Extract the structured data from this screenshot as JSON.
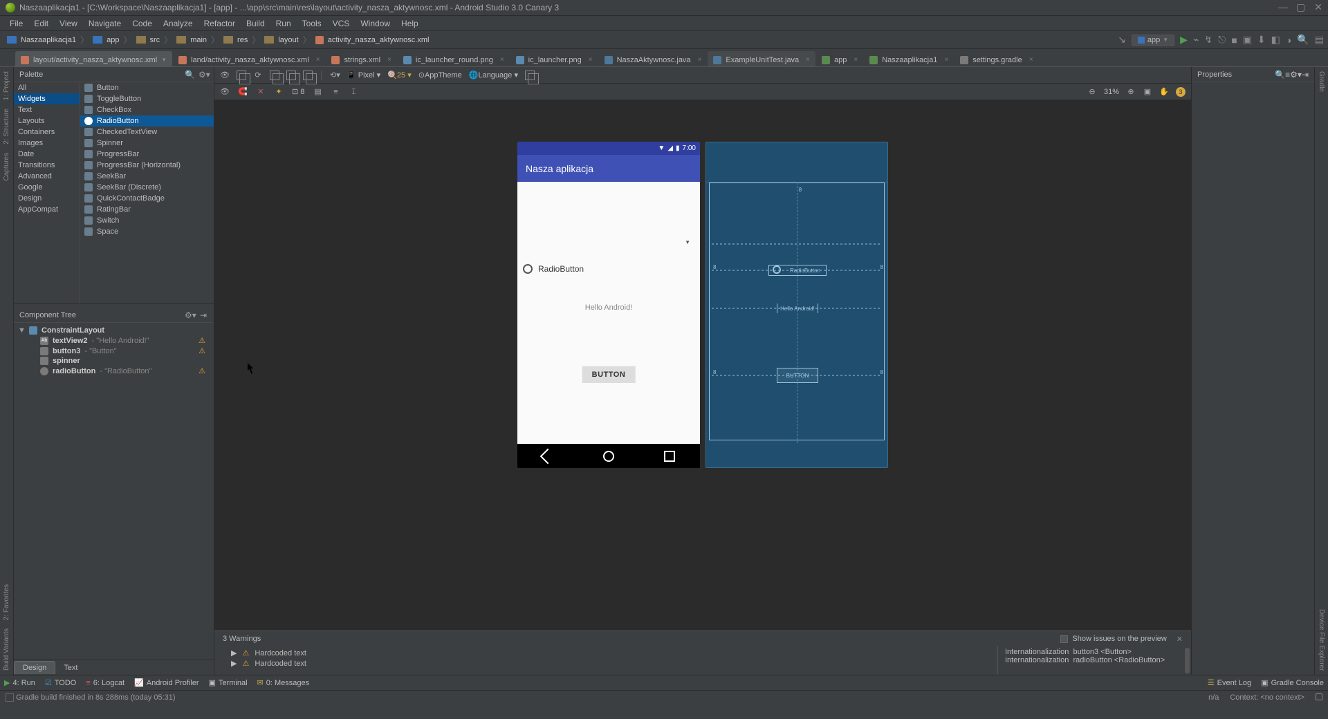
{
  "window": {
    "title": "Naszaaplikacja1 - [C:\\Workspace\\Naszaaplikacja1] - [app] - ...\\app\\src\\main\\res\\layout\\activity_nasza_aktywnosc.xml - Android Studio 3.0 Canary 3"
  },
  "menu": [
    "File",
    "Edit",
    "View",
    "Navigate",
    "Code",
    "Analyze",
    "Refactor",
    "Build",
    "Run",
    "Tools",
    "VCS",
    "Window",
    "Help"
  ],
  "breadcrumb": [
    "Naszaaplikacja1",
    "app",
    "src",
    "main",
    "res",
    "layout",
    "activity_nasza_aktywnosc.xml"
  ],
  "run_config": "app",
  "editor_tabs": [
    {
      "label": "layout/activity_nasza_aktywnosc.xml",
      "icon": "xml",
      "active": true
    },
    {
      "label": "land/activity_nasza_aktywnosc.xml",
      "icon": "xml"
    },
    {
      "label": "strings.xml",
      "icon": "xml"
    },
    {
      "label": "ic_launcher_round.png",
      "icon": "png"
    },
    {
      "label": "ic_launcher.png",
      "icon": "png"
    },
    {
      "label": "NaszaAktywnosc.java",
      "icon": "java"
    },
    {
      "label": "ExampleUnitTest.java",
      "icon": "java",
      "selected2": true
    },
    {
      "label": "app",
      "icon": "green"
    },
    {
      "label": "Naszaaplikacja1",
      "icon": "green"
    },
    {
      "label": "settings.gradle",
      "icon": "grey"
    }
  ],
  "left_gutter": [
    "1: Project",
    "2: Structure",
    "Captures"
  ],
  "left_gutter_bottom": [
    "2: Favorites",
    "Build Variants"
  ],
  "right_gutter": [
    "Gradle",
    "Device File Explorer"
  ],
  "palette": {
    "title": "Palette",
    "categories": [
      "All",
      "Widgets",
      "Text",
      "Layouts",
      "Containers",
      "Images",
      "Date",
      "Transitions",
      "Advanced",
      "Google",
      "Design",
      "AppCompat"
    ],
    "cat_selected": "Widgets",
    "items": [
      "Button",
      "ToggleButton",
      "CheckBox",
      "RadioButton",
      "CheckedTextView",
      "Spinner",
      "ProgressBar",
      "ProgressBar (Horizontal)",
      "SeekBar",
      "SeekBar (Discrete)",
      "QuickContactBadge",
      "RatingBar",
      "Switch",
      "Space"
    ],
    "item_selected": "RadioButton"
  },
  "component_tree": {
    "title": "Component Tree",
    "root": "ConstraintLayout",
    "children": [
      {
        "id": "textView2",
        "desc": "\"Hello Android!\"",
        "warn": true,
        "kind": "text"
      },
      {
        "id": "button3",
        "desc": "\"Button\"",
        "warn": true,
        "kind": "button"
      },
      {
        "id": "spinner",
        "desc": "",
        "warn": false,
        "kind": "spinner"
      },
      {
        "id": "radioButton",
        "desc": "\"RadioButton\"",
        "warn": true,
        "kind": "radio"
      }
    ]
  },
  "design_toolbar": {
    "device": "Pixel",
    "api": "25",
    "theme": "AppTheme",
    "lang": "Language"
  },
  "design_toolbar2": {
    "margin": "8",
    "zoom": "31%",
    "warn_count": "3"
  },
  "designer": {
    "time": "7:00",
    "app_title": "Nasza aplikacja",
    "radio_label": "RadioButton",
    "text_label": "Hello Android!",
    "button_label": "BUTTON"
  },
  "blueprint": {
    "margins": [
      "8",
      "8",
      "8",
      "8"
    ],
    "top_guide": "8"
  },
  "designer_tabs": [
    "Design",
    "Text"
  ],
  "properties": {
    "title": "Properties"
  },
  "warnings": {
    "title": "3 Warnings",
    "show_issues_label": "Show issues on the preview",
    "items": [
      "Hardcoded text",
      "Hardcoded text"
    ],
    "details": [
      {
        "k": "Internationalization",
        "v": "button3 <Button>"
      },
      {
        "k": "Internationalization",
        "v": "radioButton <RadioButton>"
      }
    ]
  },
  "toolstrip": {
    "items": [
      "4: Run",
      "TODO",
      "6: Logcat",
      "Android Profiler",
      "Terminal",
      "0: Messages"
    ],
    "right": [
      "Event Log",
      "Gradle Console"
    ]
  },
  "status": {
    "msg": "Gradle build finished in 8s 288ms (today 05:31)",
    "right1": "n/a",
    "right2": "Context: <no context>"
  }
}
